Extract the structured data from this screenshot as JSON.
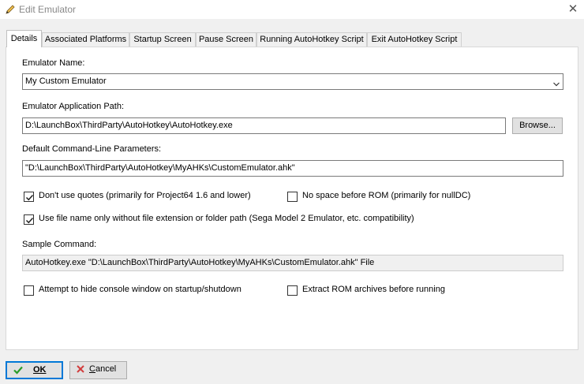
{
  "window": {
    "title": "Edit Emulator"
  },
  "tabs": [
    {
      "label": "Details"
    },
    {
      "label": "Associated Platforms"
    },
    {
      "label": "Startup Screen"
    },
    {
      "label": "Pause Screen"
    },
    {
      "label": "Running AutoHotkey Script"
    },
    {
      "label": "Exit AutoHotkey Script"
    }
  ],
  "fields": {
    "name_label": "Emulator Name:",
    "name_value": "My Custom Emulator",
    "path_label": "Emulator Application Path:",
    "path_value": "D:\\LaunchBox\\ThirdParty\\AutoHotkey\\AutoHotkey.exe",
    "browse_label": "Browse...",
    "params_label": "Default Command-Line Parameters:",
    "params_value": "\"D:\\LaunchBox\\ThirdParty\\AutoHotkey\\MyAHKs\\CustomEmulator.ahk\"",
    "sample_label": "Sample Command:",
    "sample_value": "AutoHotkey.exe \"D:\\LaunchBox\\ThirdParty\\AutoHotkey\\MyAHKs\\CustomEmulator.ahk\" File"
  },
  "checkboxes": {
    "no_quotes": {
      "label": "Don't use quotes (primarily for Project64 1.6 and lower)",
      "checked": true
    },
    "no_space": {
      "label": "No space before ROM (primarily for nullDC)",
      "checked": false
    },
    "file_name_only": {
      "label": "Use file name only without file extension or folder path (Sega Model 2 Emulator, etc. compatibility)",
      "checked": true
    },
    "hide_console": {
      "label": "Attempt to hide console window on startup/shutdown",
      "checked": false
    },
    "extract_rom": {
      "label": "Extract ROM archives before running",
      "checked": false
    }
  },
  "buttons": {
    "ok": "OK",
    "cancel": "Cancel"
  },
  "colors": {
    "accent": "#0078d7",
    "ok_check": "#2a9d2a",
    "cancel_x": "#d23c3c"
  }
}
